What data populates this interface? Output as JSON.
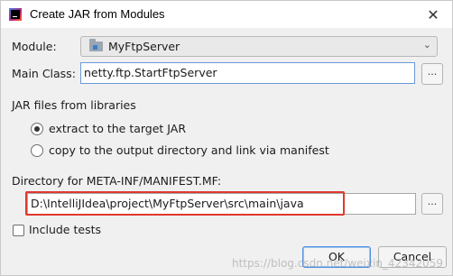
{
  "window": {
    "title": "Create JAR from Modules",
    "close_glyph": "✕",
    "app_icon": "intellij-idea-icon"
  },
  "module": {
    "label": "Module:",
    "value": "MyFtpServer",
    "icon": "module-folder-icon"
  },
  "main_class": {
    "label": "Main Class:",
    "value": "netty.ftp.StartFtpServer",
    "browse_label": "..."
  },
  "jar_files": {
    "group_label": "JAR files from libraries",
    "options": [
      {
        "label": "extract to the target JAR",
        "checked": true
      },
      {
        "label": "copy to the output directory and link via manifest",
        "checked": false
      }
    ]
  },
  "manifest_dir": {
    "label": "Directory for META-INF/MANIFEST.MF:",
    "value": "D:\\IntelliJIdea\\project\\MyFtpServer\\src\\main\\java",
    "browse_label": "..."
  },
  "include_tests": {
    "label": "Include tests",
    "checked": false
  },
  "buttons": {
    "ok": "OK",
    "cancel": "Cancel"
  },
  "watermark": "https://blog.csdn.net/weixin_42342059",
  "colors": {
    "highlight": "#e0382f",
    "focus_border": "#6a9ad6"
  }
}
